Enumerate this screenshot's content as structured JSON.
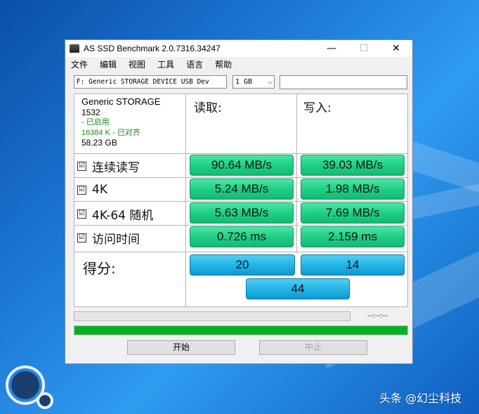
{
  "window": {
    "title": "AS SSD Benchmark 2.0.7316.34247",
    "min": "—",
    "max": "☐",
    "close": "✕"
  },
  "menu": [
    "文件",
    "编辑",
    "视图",
    "工具",
    "语言",
    "帮助"
  ],
  "toolbar": {
    "drive": "F: Generic STORAGE DEVICE USB Dev",
    "size": "1 GB",
    "dropdown_icon": "chevron-down-icon"
  },
  "device": {
    "name": "Generic STORAGE",
    "model": "1532",
    "status1": " - 已启用",
    "status2": "16384 K - 已对齐",
    "capacity": "58.23 GB"
  },
  "columns": {
    "read": "读取:",
    "write": "写入:"
  },
  "rows": [
    {
      "label": "连续读写",
      "read": "90.64 MB/s",
      "write": "39.03 MB/s",
      "checked": true
    },
    {
      "label": "4K",
      "read": "5.24 MB/s",
      "write": "1.98 MB/s",
      "checked": true
    },
    {
      "label": "4K-64 随机",
      "read": "5.63 MB/s",
      "write": "7.69 MB/s",
      "checked": true
    },
    {
      "label": "访问时间",
      "read": "0.726 ms",
      "write": "2.159 ms",
      "checked": true
    }
  ],
  "score": {
    "label": "得分:",
    "read": "20",
    "write": "14",
    "total": "44"
  },
  "progress": {
    "time": "--:--:--",
    "total_fill": 1.0,
    "fill_color": "#06b025"
  },
  "buttons": {
    "start": "开始",
    "stop": "中止"
  },
  "colors": {
    "cell_green": "#1fcf86",
    "score_blue": "#20b2e6"
  },
  "watermark": "头条 @幻尘科技",
  "checkbox_glyph": "☑"
}
